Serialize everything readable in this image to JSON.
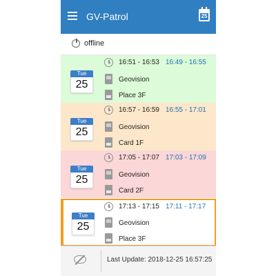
{
  "app": {
    "title": "GV-Patrol",
    "calendar_icon_day": "25",
    "menu_icon": "menu-icon",
    "calendar_icon": "calendar-icon"
  },
  "status": {
    "icon": "offline-icon",
    "text": "offline"
  },
  "colors": {
    "primary": "#2f7fc1",
    "time_actual": "#1e72b8",
    "card_green": "#dcfbd8",
    "card_orange": "#fde7cb",
    "card_red": "#fbd7d7",
    "selected_border": "#f39c1f"
  },
  "cards": [
    {
      "day_name": "Tue",
      "day_num": "25",
      "scheduled_time": "16:51 - 16:53",
      "actual_time": "16:49 - 16:55",
      "device": "Geovision",
      "checkpoint": "Place 3F",
      "status_color": "green"
    },
    {
      "day_name": "Tue",
      "day_num": "25",
      "scheduled_time": "16:57 - 16:59",
      "actual_time": "16:55 - 17:01",
      "device": "Geovision",
      "checkpoint": "Card 1F",
      "status_color": "orange"
    },
    {
      "day_name": "Tue",
      "day_num": "25",
      "scheduled_time": "17:05 - 17:07",
      "actual_time": "17:03 - 17:09",
      "device": "Geovision",
      "checkpoint": "Card 2F",
      "status_color": "red"
    },
    {
      "day_name": "Tue",
      "day_num": "25",
      "scheduled_time": "17:13 - 17:15",
      "actual_time": "17:11 - 17:17",
      "device": "Geovision",
      "checkpoint": "Place 3F",
      "status_color": "white",
      "selected": true
    }
  ],
  "footer": {
    "toggle_icon": "hide-icon",
    "last_update": "Last Update: 2018-12-25 16:57:25"
  }
}
